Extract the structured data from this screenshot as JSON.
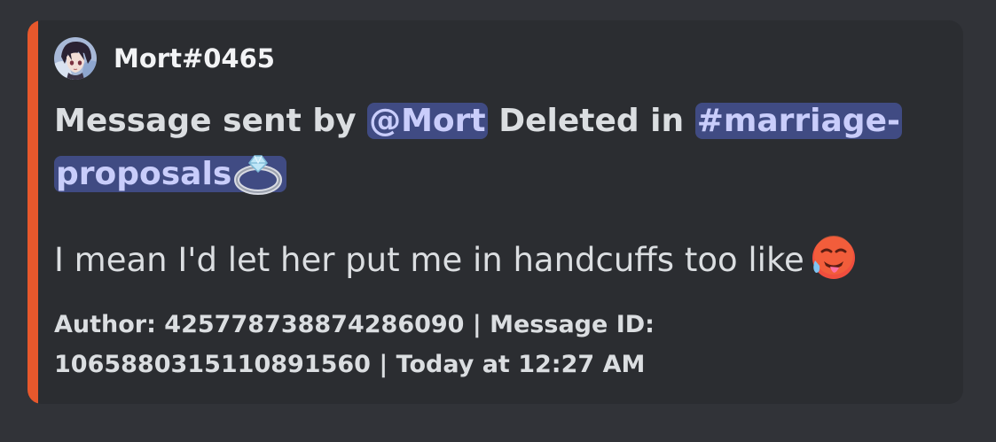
{
  "embed": {
    "accent_color": "#e7582c",
    "author": {
      "name": "Mort#0465",
      "avatar_icon": "anime-avatar"
    },
    "title": {
      "prefix": "Message sent by",
      "user_mention": "@Mort",
      "middle": "Deleted in",
      "channel_mention": "#marriage-proposals",
      "channel_emoji": "ring-emoji"
    },
    "description": {
      "text": "I mean I'd let her put me in handcuffs too like",
      "emoji": "hot-face-emoji"
    },
    "footer": {
      "text": "Author: 425778738874286090 | Message ID: 1065880315110891560 | Today at 12:27 AM"
    }
  }
}
